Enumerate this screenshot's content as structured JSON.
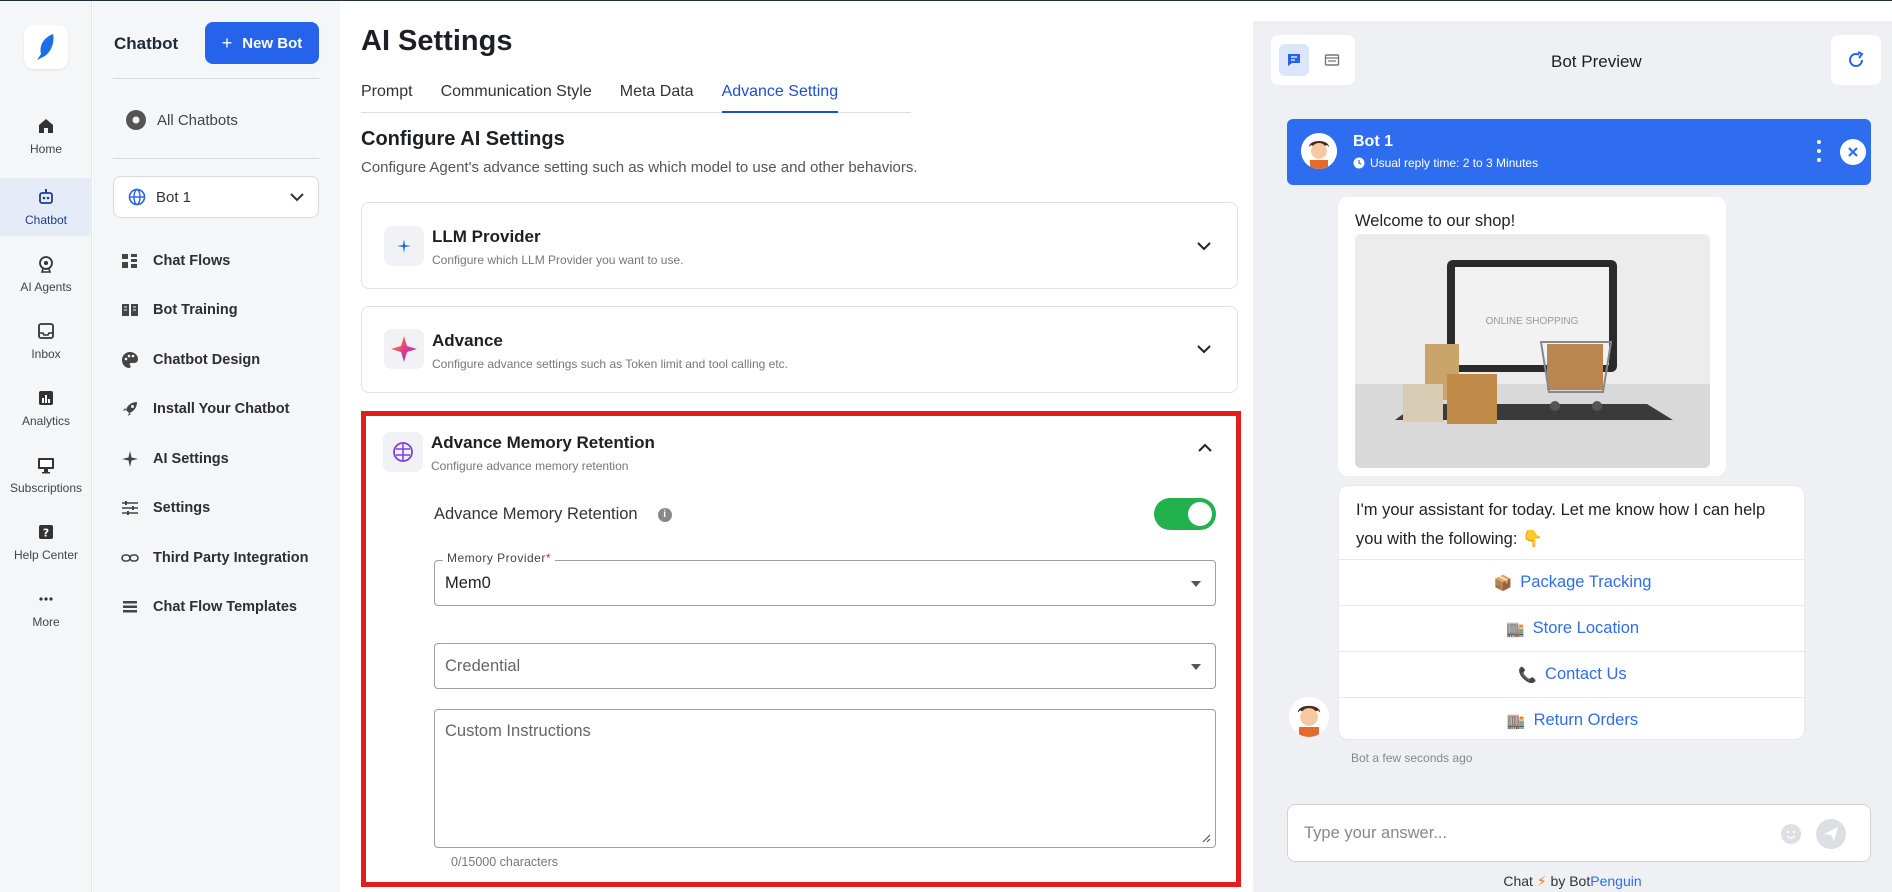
{
  "rail": {
    "items": [
      {
        "label": "Home",
        "icon": "home-icon"
      },
      {
        "label": "Chatbot",
        "icon": "robot-icon"
      },
      {
        "label": "AI Agents",
        "icon": "ai-agent-icon"
      },
      {
        "label": "Inbox",
        "icon": "inbox-icon"
      },
      {
        "label": "Analytics",
        "icon": "analytics-icon"
      },
      {
        "label": "Subscriptions",
        "icon": "monitor-icon"
      },
      {
        "label": "Help Center",
        "icon": "help-icon"
      },
      {
        "label": "More",
        "icon": "more-icon"
      }
    ],
    "active": "Chatbot"
  },
  "sidebar": {
    "title": "Chatbot",
    "new_bot_label": "New Bot",
    "all_chatbots_label": "All Chatbots",
    "bot_selector_value": "Bot 1",
    "items": [
      {
        "label": "Chat Flows",
        "icon": "chat-flows-icon"
      },
      {
        "label": "Bot Training",
        "icon": "book-icon"
      },
      {
        "label": "Chatbot Design",
        "icon": "palette-icon"
      },
      {
        "label": "Install Your Chatbot",
        "icon": "rocket-icon"
      },
      {
        "label": "AI Settings",
        "icon": "sparkle-icon"
      },
      {
        "label": "Settings",
        "icon": "sliders-icon"
      },
      {
        "label": "Third Party Integration",
        "icon": "link-icon"
      },
      {
        "label": "Chat Flow Templates",
        "icon": "template-icon"
      }
    ]
  },
  "main": {
    "title": "AI Settings",
    "tabs": [
      "Prompt",
      "Communication Style",
      "Meta Data",
      "Advance Setting"
    ],
    "active_tab": "Advance Setting",
    "section_title": "Configure AI Settings",
    "section_subtitle": "Configure Agent's advance setting such as which model to use and other behaviors.",
    "cards": [
      {
        "title": "LLM Provider",
        "subtitle": "Configure which LLM Provider you want to use."
      },
      {
        "title": "Advance",
        "subtitle": "Configure advance settings such as Token limit and tool calling etc."
      },
      {
        "title": "Advance Memory Retention",
        "subtitle": "Configure advance memory retention"
      }
    ],
    "memory": {
      "toggle_label": "Advance Memory Retention",
      "toggle_on": true,
      "provider_label": "Memory Provider",
      "provider_required": "*",
      "provider_value": "Mem0",
      "credential_placeholder": "Credential",
      "instructions_placeholder": "Custom Instructions",
      "char_count": "0/15000 characters"
    }
  },
  "preview": {
    "title": "Bot Preview",
    "bot_name": "Bot 1",
    "reply_time": "Usual reply time: 2 to 3 Minutes",
    "welcome": "Welcome to our shop!",
    "image_text": "ONLINE SHOPPING",
    "assistant_msg": "I'm your assistant for today. Let me know how I can help you with the following: 👇",
    "options": [
      {
        "emoji": "📦",
        "label": "Package Tracking"
      },
      {
        "emoji": "🏬",
        "label": "Store Location"
      },
      {
        "emoji": "📞",
        "label": "Contact Us"
      },
      {
        "emoji": "🏬",
        "label": "Return Orders"
      }
    ],
    "timestamp": "Bot a few seconds ago",
    "input_placeholder": "Type your answer...",
    "powered_prefix": "Chat",
    "powered_by": "by Bot",
    "powered_brand": "Penguin"
  },
  "colors": {
    "accent": "#2563eb",
    "highlight": "#e11d1d",
    "toggle_on": "#22b14c",
    "chat_header": "#2f6df0"
  }
}
